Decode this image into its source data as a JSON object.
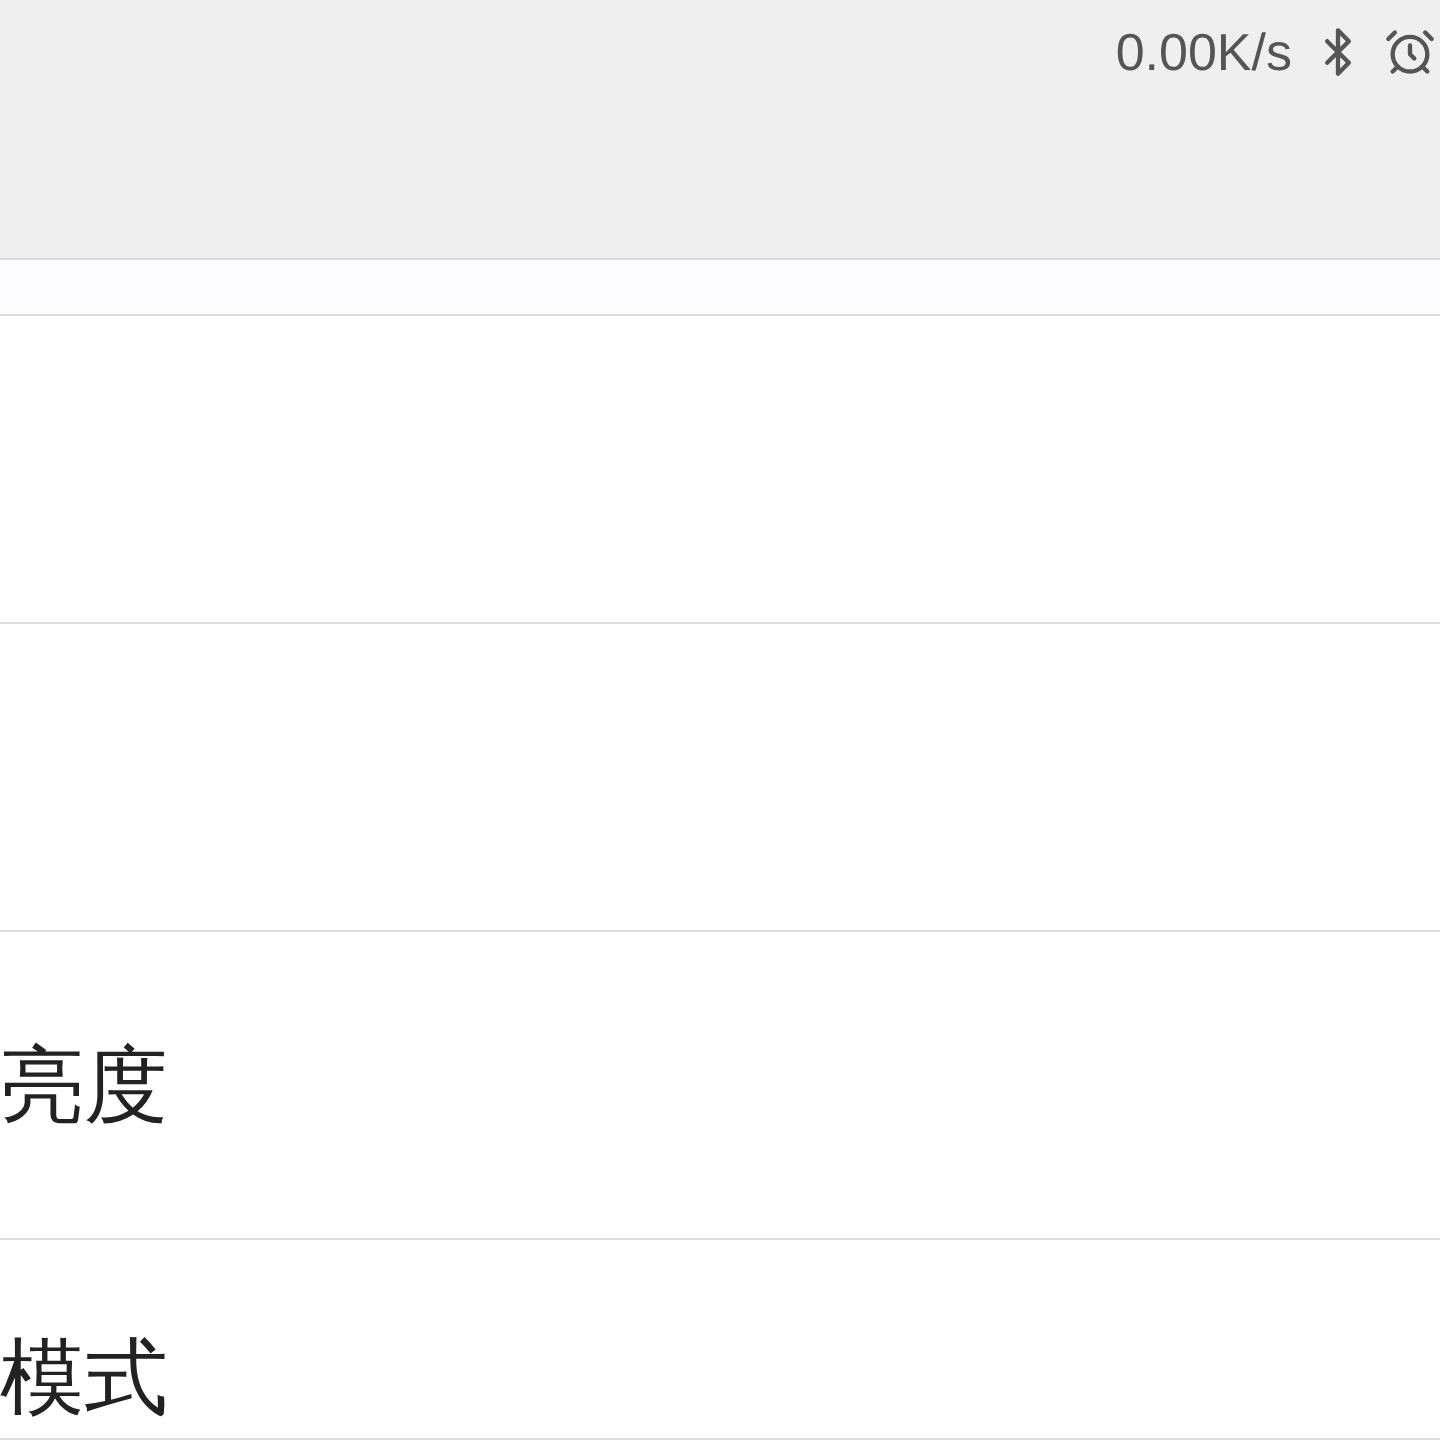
{
  "status_bar": {
    "network_speed": "0.00K/s"
  },
  "settings_rows": [
    {
      "label": ""
    },
    {
      "label": ""
    },
    {
      "label": "亮度"
    },
    {
      "label": "模式"
    }
  ]
}
